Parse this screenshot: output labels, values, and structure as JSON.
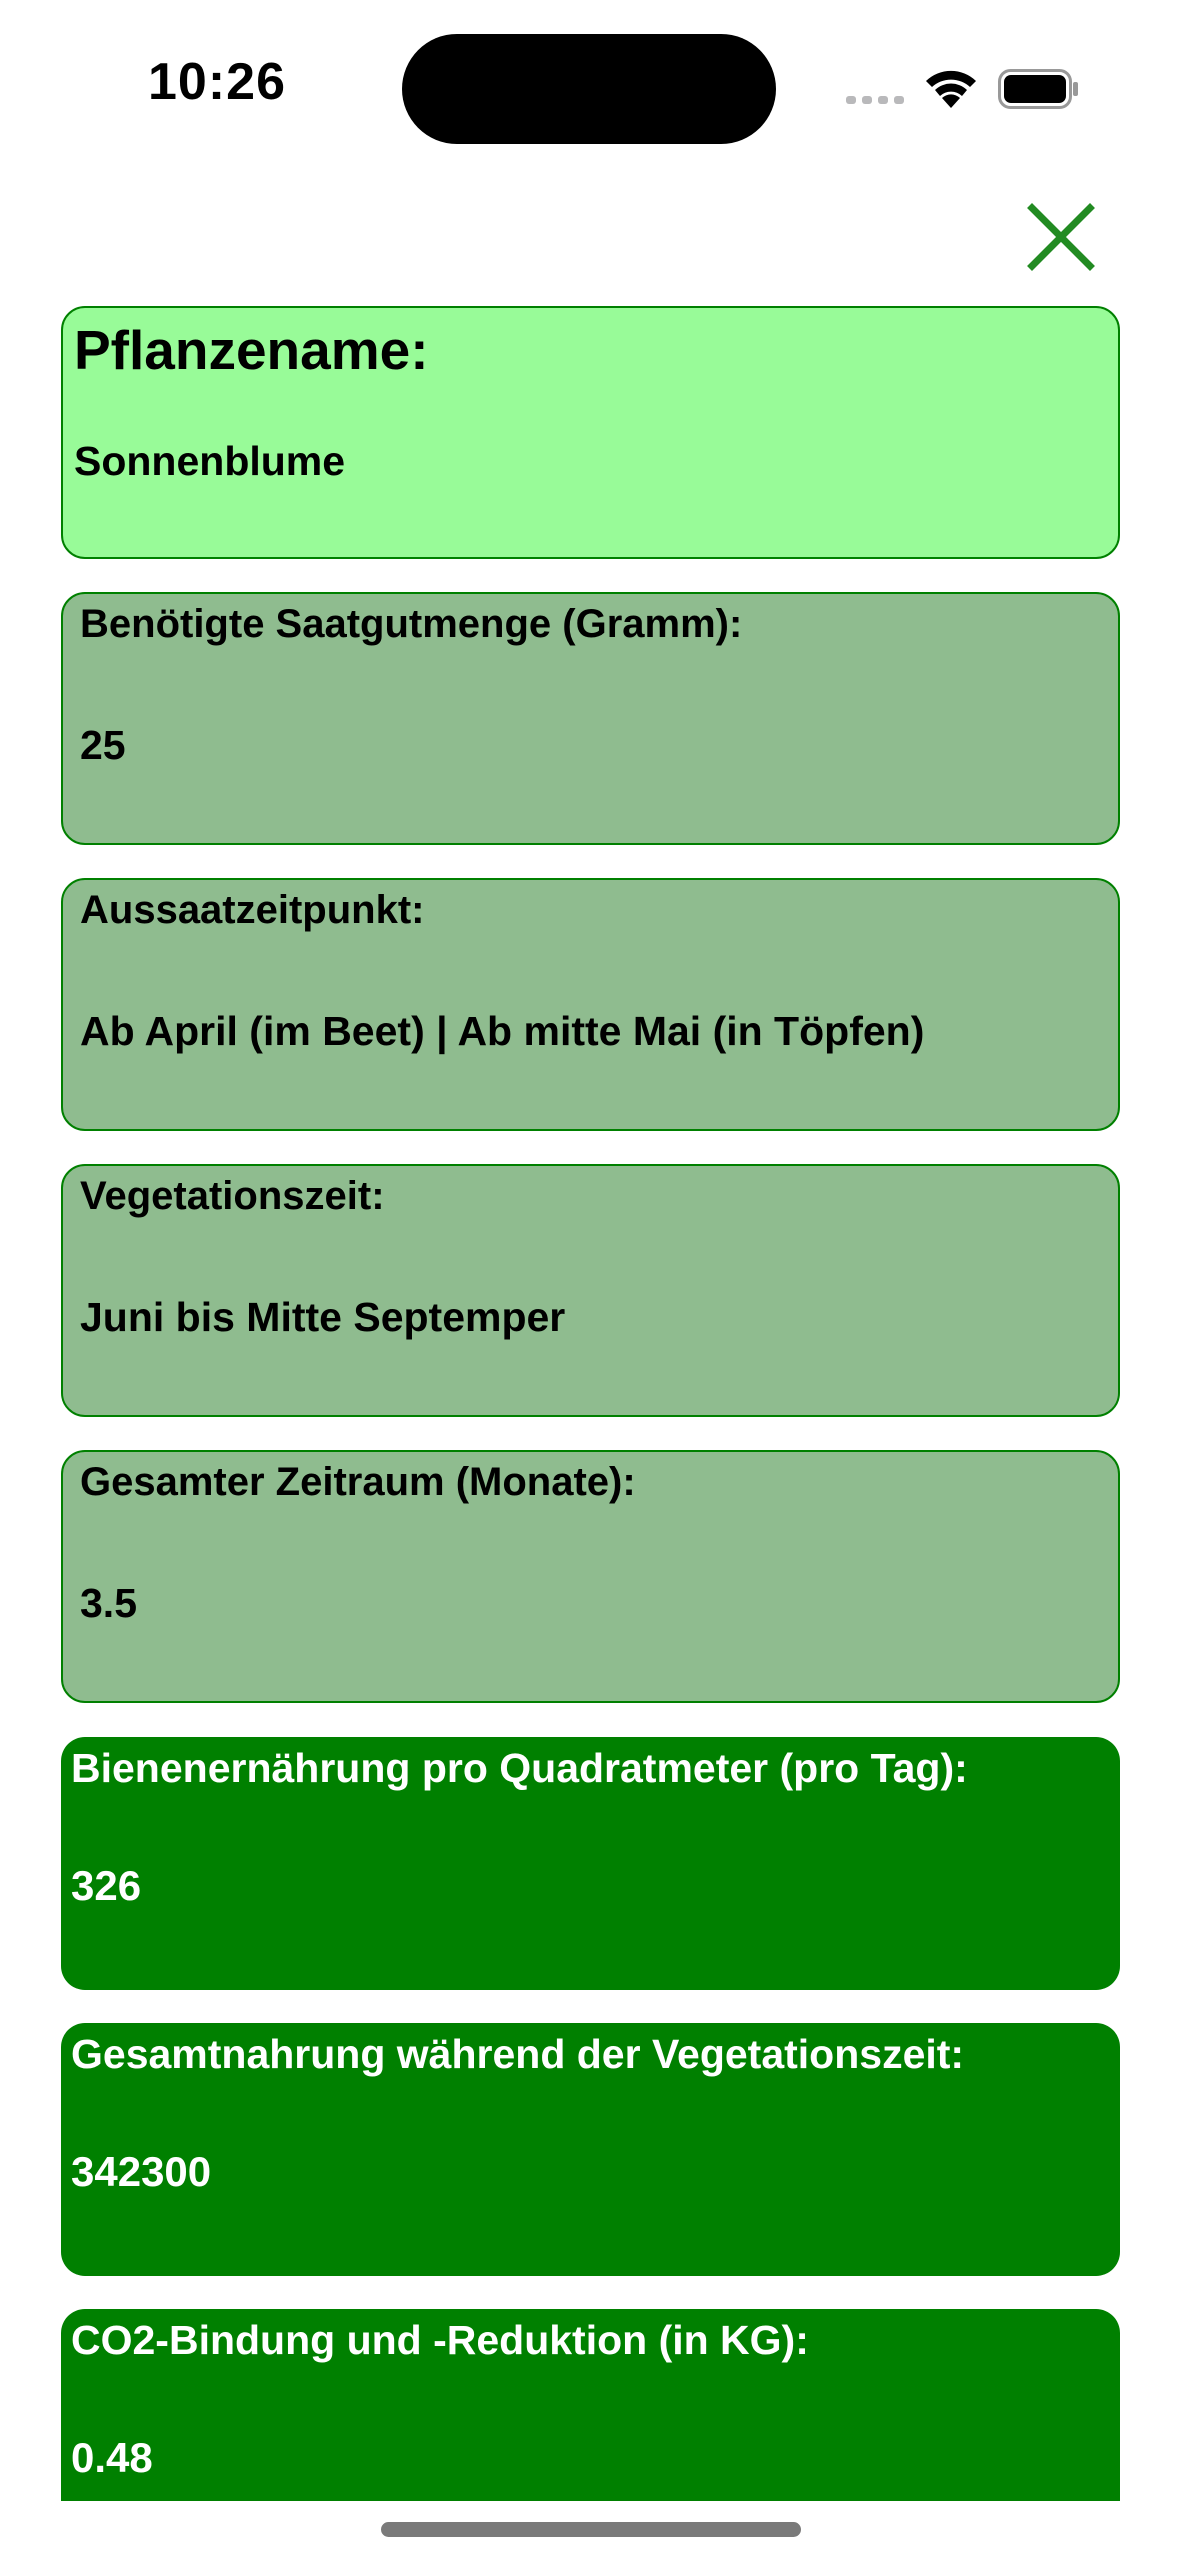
{
  "status_bar": {
    "time": "10:26",
    "icons": [
      "signal-dots-icon",
      "wifi-icon",
      "battery-icon"
    ]
  },
  "header": {
    "close_icon": "close-icon",
    "close_color": "#228b22"
  },
  "colors": {
    "name_card_bg": "#98fb98",
    "muted_card_bg": "#8fbc8f",
    "dark_card_bg": "#008000",
    "card_border": "#008000"
  },
  "plant": {
    "name": {
      "label": "Pflanzename:",
      "value": "Sonnenblume"
    },
    "seed_amount": {
      "label": "Benötigte Saatgutmenge (Gramm):",
      "value": "25"
    },
    "sowing_time": {
      "label": "Aussaatzeitpunkt:",
      "value": "Ab April (im Beet) | Ab mitte Mai (in Töpfen)"
    },
    "vegetation_period": {
      "label": "Vegetationszeit:",
      "value": "Juni bis Mitte Septemper"
    },
    "total_period": {
      "label": "Gesamter Zeitraum (Monate):",
      "value": "3.5"
    },
    "bee_nutrition": {
      "label": "Bienenernährung pro Quadratmeter (pro Tag):",
      "value": "326"
    },
    "total_nutrition": {
      "label": "Gesamtnahrung während der Vegetationszeit:",
      "value": "342300"
    },
    "co2": {
      "label": "CO2-Bindung und -Reduktion (in KG):",
      "value": "0.48"
    }
  }
}
